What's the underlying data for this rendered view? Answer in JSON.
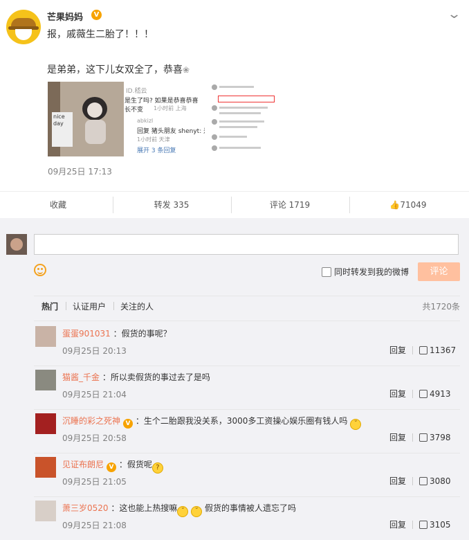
{
  "post": {
    "author": "芒果妈妈",
    "verified_badge": "V",
    "text_line1": "报，戚薇生二胎了！！！",
    "text_line2": "是弟弟，这下儿女双全了，恭喜",
    "date": "09月25日 17:13",
    "image2_lines": [
      "ID.嵇云",
      "是生了吗? 如果是恭喜恭喜",
      "长不变",
      "1小时前 上海",
      "abkizl",
      "回复 猪头朋友 shenyt: 是弟",
      "1小时前 天津",
      "展开 3 条回复"
    ],
    "image1_note": "nice day"
  },
  "actions": {
    "favorite": "收藏",
    "repost": "转发 335",
    "comment": "评论 1719",
    "like": "71049"
  },
  "composer": {
    "input_value": "",
    "repost_label": "同时转发到我的微博",
    "submit_label": "评论"
  },
  "tabs": {
    "hot": "热门",
    "verified": "认证用户",
    "following": "关注的人",
    "total": "共1720条"
  },
  "comments": [
    {
      "name": "蛋蛋901031",
      "verified": false,
      "text": "：假货的事呢？",
      "time": "09月25日 20:13",
      "reply": "回复",
      "likes": "11367"
    },
    {
      "name": "猫酱_千金",
      "verified": false,
      "text": "：所以卖假货的事过去了是吗",
      "time": "09月25日 21:04",
      "reply": "回复",
      "likes": "4913"
    },
    {
      "name": "沉睡的彩之死神",
      "verified": true,
      "text": "：生个二胎跟我没关系，3000多工资操心娱乐圈有钱人吗",
      "time": "09月25日 20:58",
      "reply": "回复",
      "likes": "3798"
    },
    {
      "name": "见证布朗尼",
      "verified": true,
      "text": "：假货呢",
      "time": "09月25日 21:05",
      "reply": "回复",
      "likes": "3080"
    },
    {
      "name": "萧三岁0520",
      "verified": false,
      "text": "：这也能上热搜嘛",
      "text2": "假货的事情被人遗忘了吗",
      "time": "09月25日 21:08",
      "reply": "回复",
      "likes": "3105"
    }
  ],
  "colors": {
    "accent": "#eb7350",
    "badge": "#f7a300",
    "submit_disabled": "#ffc09f"
  }
}
